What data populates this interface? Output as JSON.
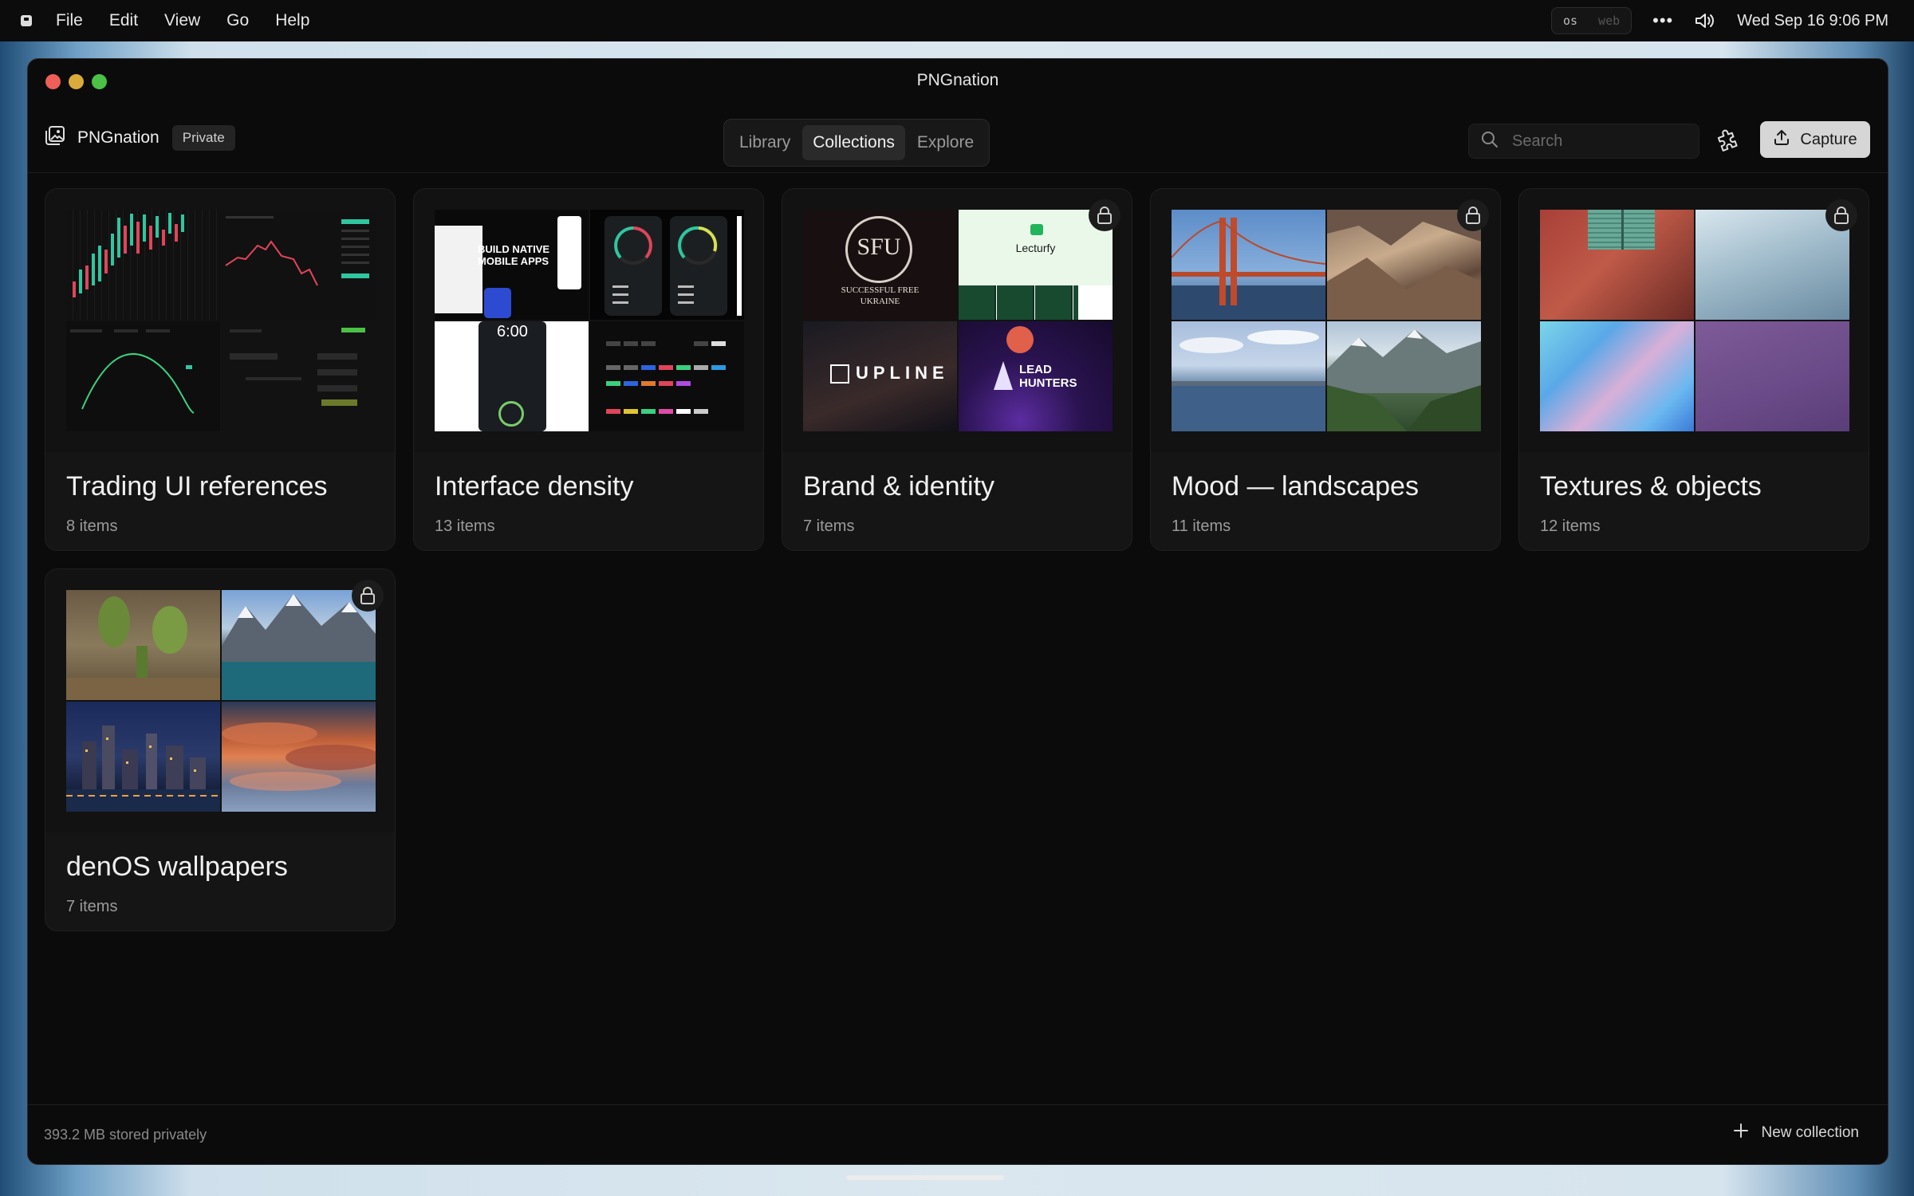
{
  "menubar": {
    "items": [
      "File",
      "Edit",
      "View",
      "Go",
      "Help"
    ],
    "segment": [
      "os",
      "web"
    ],
    "more": "•••",
    "clock": "Wed Sep 16 9:06 PM"
  },
  "window": {
    "title": "PNGnation"
  },
  "toolbar": {
    "app_name": "PNGnation",
    "privacy_badge": "Private",
    "tabs": [
      "Library",
      "Collections",
      "Explore"
    ],
    "active_tab": "Collections",
    "search_placeholder": "Search",
    "capture_label": "Capture"
  },
  "collections": [
    {
      "title": "Trading UI references",
      "count": "8 items",
      "locked": false
    },
    {
      "title": "Interface density",
      "count": "13 items",
      "locked": false
    },
    {
      "title": "Brand & identity",
      "count": "7 items",
      "locked": true
    },
    {
      "title": "Mood — landscapes",
      "count": "11 items",
      "locked": true
    },
    {
      "title": "Textures & objects",
      "count": "12 items",
      "locked": true
    },
    {
      "title": "denOS wallpapers",
      "count": "7 items",
      "locked": true
    }
  ],
  "thumb_text": {
    "build_native": "BUILD NATIVE MOBILE APPS",
    "time": "6:00",
    "sfu": "SFU",
    "sfu_caption": "SUCCESSFUL FREE UKRAINE",
    "lecturfy": "Lecturfy",
    "upline": "UPLINE",
    "lead_hunters": "LEAD HUNTERS"
  },
  "footer": {
    "storage": "393.2 MB stored privately",
    "new_collection": "New collection"
  },
  "colors": {
    "window_bg": "#0b0b0b",
    "card_bg": "#151515",
    "capture_bg": "#d6d6d6",
    "traffic_red": "#ee5f58",
    "traffic_yellow": "#d9ab3a",
    "traffic_green": "#4bc148"
  }
}
